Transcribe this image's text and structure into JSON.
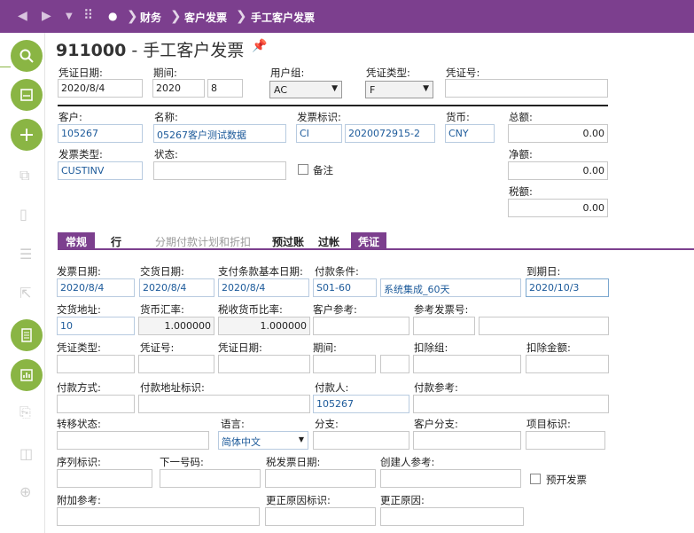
{
  "nav": {
    "crumbs": [
      "财务",
      "客户发票",
      "手工客户发票"
    ]
  },
  "page": {
    "code": "911000",
    "dash": "-",
    "name": "手工客户发票"
  },
  "header": {
    "voucher_date_label": "凭证日期:",
    "voucher_date": "2020/8/4",
    "period_label": "期间:",
    "period_year": "2020",
    "period_num": "8",
    "user_group_label": "用户组:",
    "user_group": "AC",
    "voucher_type_label": "凭证类型:",
    "voucher_type": "F",
    "voucher_no_label": "凭证号:",
    "voucher_no": ""
  },
  "customer": {
    "customer_label": "客户:",
    "customer": "105267",
    "name_label": "名称:",
    "name": "05267客户测试数据",
    "invoice_id_label": "发票标识:",
    "invoice_id_prefix": "CI",
    "invoice_id": "2020072915-2",
    "currency_label": "货币:",
    "currency": "CNY",
    "total_label": "总额:",
    "total": "0.00",
    "invoice_type_label": "发票类型:",
    "invoice_type": "CUSTINV",
    "status_label": "状态:",
    "status": "",
    "note_label": "备注",
    "net_label": "净额:",
    "net": "0.00",
    "tax_label": "税额:",
    "tax": "0.00"
  },
  "tabs": [
    {
      "label": "常规",
      "state": "active"
    },
    {
      "label": "行",
      "state": "normal"
    },
    {
      "label": "分期付款计划和折扣",
      "state": "disabled"
    },
    {
      "label": "预过账",
      "state": "normal"
    },
    {
      "label": "过帐",
      "state": "normal"
    },
    {
      "label": "凭证",
      "state": "active"
    }
  ],
  "general": {
    "invoice_date_label": "发票日期:",
    "invoice_date": "2020/8/4",
    "delivery_date_label": "交货日期:",
    "delivery_date": "2020/8/4",
    "pay_base_date_label": "支付条款基本日期:",
    "pay_base_date": "2020/8/4",
    "pay_terms_label": "付款条件:",
    "pay_terms_code": "S01-60",
    "pay_terms_desc": "系统集成_60天",
    "due_date_label": "到期日:",
    "due_date": "2020/10/3",
    "delivery_addr_label": "交货地址:",
    "delivery_addr": "10",
    "currency_rate_label": "货币汇率:",
    "currency_rate": "1.000000",
    "tax_rate_label": "税收货币比率:",
    "tax_rate": "1.000000",
    "cust_ref_label": "客户参考:",
    "cust_ref": "",
    "ref_invoice_label": "参考发票号:",
    "ref_invoice": "",
    "v_type_label": "凭证类型:",
    "v_type": "",
    "v_no_label": "凭证号:",
    "v_no": "",
    "v_date_label": "凭证日期:",
    "v_date": "",
    "v_period_label": "期间:",
    "v_period": "",
    "deduct_group_label": "扣除组:",
    "deduct_group": "",
    "deduct_amount_label": "扣除金额:",
    "deduct_amount": "",
    "pay_method_label": "付款方式:",
    "pay_method": "",
    "pay_addr_label": "付款地址标识:",
    "pay_addr": "",
    "payer_label": "付款人:",
    "payer": "105267",
    "pay_ref_label": "付款参考:",
    "pay_ref": "",
    "transfer_label": "转移状态:",
    "transfer": "",
    "language_label": "语言:",
    "language": "简体中文",
    "branch_label": "分支:",
    "branch": "",
    "cust_branch_label": "客户分支:",
    "cust_branch": "",
    "project_label": "项目标识:",
    "project": "",
    "serial_label": "序列标识:",
    "serial": "",
    "next_no_label": "下一号码:",
    "next_no": "",
    "tax_inv_date_label": "税发票日期:",
    "tax_inv_date": "",
    "creator_ref_label": "创建人参考:",
    "creator_ref": "",
    "prepay_label": "预开发票",
    "extra_ref_label": "附加参考:",
    "extra_ref": "",
    "corr_reason_id_label": "更正原因标识:",
    "corr_reason_id": "",
    "corr_reason_label": "更正原因:",
    "corr_reason": ""
  }
}
